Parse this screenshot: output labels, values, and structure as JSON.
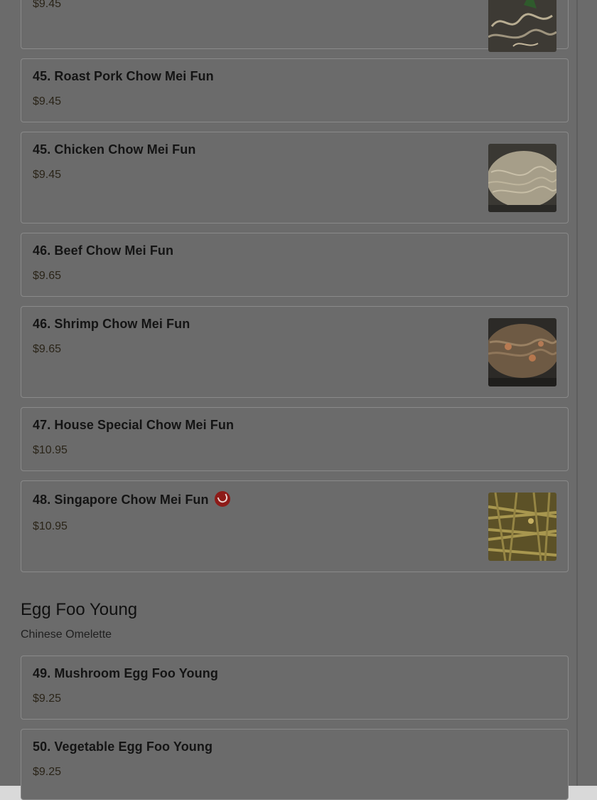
{
  "items": [
    {
      "name": "",
      "price": "$9.45",
      "image": "noodle-dish-photo"
    },
    {
      "name": "45. Roast Pork Chow Mei Fun",
      "price": "$9.45"
    },
    {
      "name": "45. Chicken Chow Mei Fun",
      "price": "$9.45",
      "image": "noodle-dish-photo"
    },
    {
      "name": "46. Beef Chow Mei Fun",
      "price": "$9.65"
    },
    {
      "name": "46. Shrimp Chow Mei Fun",
      "price": "$9.65",
      "image": "noodle-dish-photo"
    },
    {
      "name": "47. House Special Chow Mei Fun",
      "price": "$10.95"
    },
    {
      "name": "48. Singapore Chow Mei Fun",
      "price": "$10.95",
      "image": "noodle-dish-photo",
      "badge_icon": "spicy-icon",
      "badge_color": "#8d1b18"
    }
  ],
  "section": {
    "title": "Egg Foo Young",
    "subtitle": "Chinese Omelette",
    "items": [
      {
        "name": "49. Mushroom Egg Foo Young",
        "price": "$9.25"
      },
      {
        "name": "50. Vegetable Egg Foo Young",
        "price": "$9.25"
      }
    ]
  },
  "colors": {
    "overlay": "#6b6b6b",
    "accent": "#8d1b18"
  }
}
